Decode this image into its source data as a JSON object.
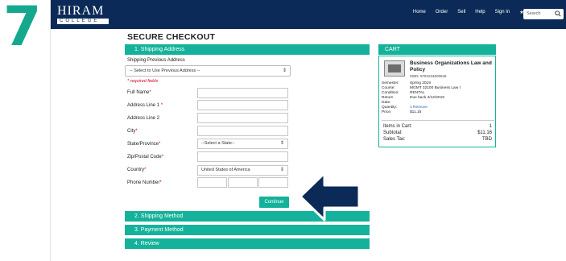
{
  "badge": {
    "step_number": "7"
  },
  "nav": {
    "logo_word": "HIRAM",
    "logo_sub": "COLLEGE",
    "links": [
      "Home",
      "Order",
      "Sell",
      "Help",
      "Sign In",
      "★(1)"
    ],
    "search_placeholder": "Search"
  },
  "checkout": {
    "title": "SECURE CHECKOUT",
    "step1": "1. Shipping Address",
    "prev_label": "Shipping Previous Address",
    "prev_select": "-- Select to Use Previous Address --",
    "required_note": "* required fields",
    "fields": {
      "full_name": "Full Name",
      "address1": "Address Line 1",
      "address2": "Address Line 2",
      "city": "City",
      "state": "State/Province",
      "zip": "Zip/Postal Code",
      "country": "Country",
      "phone": "Phone Number"
    },
    "state_select": "--Select a State--",
    "country_select": "United States of America",
    "continue_label": "Continue",
    "step2": "2. Shipping Method",
    "step3": "3. Payment Method",
    "step4": "4. Review"
  },
  "cart": {
    "title": "CART",
    "book_title": "Business Organizations Law and Policy",
    "isbn": "ISBN: 9781634605946",
    "meta": [
      {
        "k": "Semester:",
        "v": "Spring 2019"
      },
      {
        "k": "Course:",
        "v": "MGMT 32100 Business Law I"
      },
      {
        "k": "Condition:",
        "v": "RENTAL"
      },
      {
        "k": "Return",
        "v": "Due back 4/12/2019"
      },
      {
        "k": "Date:",
        "v": ""
      },
      {
        "k": "Quantity:",
        "v": "1",
        "link": "Remove"
      },
      {
        "k": "Price:",
        "v": "$11.16"
      }
    ],
    "items_label": "Items in Cart:",
    "items_value": "1",
    "subtotal_label": "Subtotal:",
    "subtotal_value": "$11.16",
    "tax_label": "Sales Tax:",
    "tax_value": "TBD"
  },
  "colors": {
    "navy": "#0b2a57",
    "teal": "#14b29a",
    "badge_green": "#14a98f",
    "required": "#d0021b"
  },
  "icons": {
    "search": "search-icon",
    "arrow": "pointer-arrow-icon",
    "chevron": "select-chevron-icon"
  }
}
